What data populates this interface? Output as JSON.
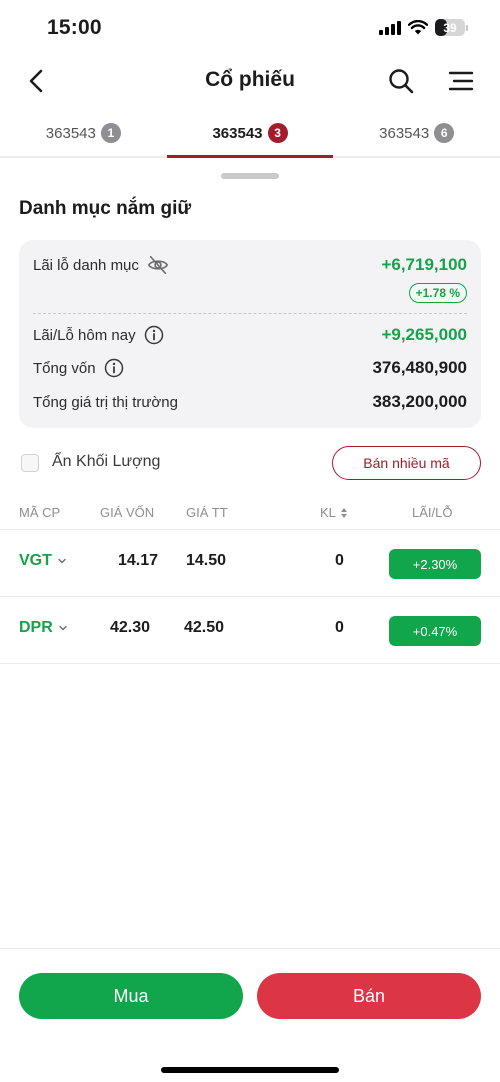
{
  "status_bar": {
    "time": "15:00",
    "battery": "39",
    "battery_level": 0.39
  },
  "nav": {
    "title": "Cổ phiếu"
  },
  "tabs": [
    {
      "label": "363543",
      "badge": "1"
    },
    {
      "label": "363543",
      "badge": "3"
    },
    {
      "label": "363543",
      "badge": "6"
    }
  ],
  "active_tab": 1,
  "portfolio": {
    "title": "Danh mục nắm giữ",
    "pl_label": "Lãi lỗ danh mục",
    "pl_value": "+6,719,100",
    "pl_pct": "+1.78 %",
    "today_label": "Lãi/Lỗ hôm nay",
    "today_value": "+9,265,000",
    "capital_label": "Tổng vốn",
    "capital_value": "376,480,900",
    "market_label": "Tổng giá trị thị trường",
    "market_value": "383,200,000"
  },
  "options": {
    "hide_volume_label": "Ẩn Khối Lượng",
    "sell_many_label": "Bán nhiều mã"
  },
  "table": {
    "headers": {
      "ticker": "MÃ CP",
      "cost": "GIÁ VỐN",
      "market": "GIÁ TT",
      "volume": "KL",
      "pl": "LÃI/LỖ"
    },
    "rows": [
      {
        "ticker": "VGT",
        "cost": "14.17",
        "market": "14.50",
        "volume": "0",
        "pl": "+2.30%"
      },
      {
        "ticker": "DPR",
        "cost": "42.30",
        "market": "42.50",
        "volume": "0",
        "pl": "+0.47%"
      }
    ]
  },
  "actions": {
    "buy": "Mua",
    "sell": "Bán"
  },
  "colors": {
    "brand": "#a21c2b",
    "up": "#17a34a",
    "buy": "#12a64c",
    "sell": "#dc3545"
  }
}
